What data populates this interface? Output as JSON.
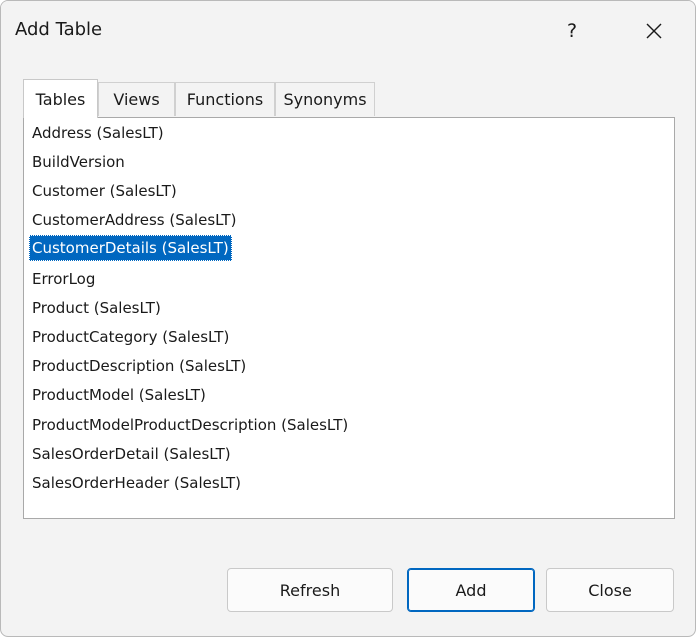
{
  "window": {
    "title": "Add Table",
    "help_label": "?"
  },
  "tabs": [
    {
      "label": "Tables",
      "selected": true
    },
    {
      "label": "Views",
      "selected": false
    },
    {
      "label": "Functions",
      "selected": false
    },
    {
      "label": "Synonyms",
      "selected": false
    }
  ],
  "tables": [
    "Address (SalesLT)",
    "BuildVersion",
    "Customer (SalesLT)",
    "CustomerAddress (SalesLT)",
    "CustomerDetails (SalesLT)",
    "ErrorLog",
    "Product (SalesLT)",
    "ProductCategory (SalesLT)",
    "ProductDescription (SalesLT)",
    "ProductModel (SalesLT)",
    "ProductModelProductDescription (SalesLT)",
    "SalesOrderDetail (SalesLT)",
    "SalesOrderHeader (SalesLT)"
  ],
  "selected_table": "CustomerDetails (SalesLT)",
  "buttons": {
    "refresh_label": "Refresh",
    "add_label": "Add",
    "close_label": "Close"
  },
  "colors": {
    "selection": "#0067c0",
    "default_button_border": "#0067c0",
    "dialog_background": "#f3f3f3"
  }
}
